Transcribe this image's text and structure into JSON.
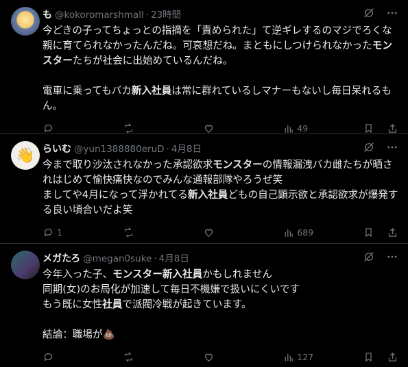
{
  "tweets": [
    {
      "name": "も",
      "handle": "@kokoromarshmall",
      "time": "23時間",
      "text": "今どきの子ってちょっとの指摘を「責められた」て逆ギレするのマジでろくな親に育てられなかったんだね。可哀想だね。まともにしつけられなかった<b>モンスター</b>たちが社会に出始めているんだね。\n\n電車に乗ってもバカ<b>新入社員</b>は常に群れているしマナーもないし毎日呆れるもん。",
      "replies": "",
      "reposts": "",
      "likes": "",
      "views": "49"
    },
    {
      "name": "らいむ",
      "handle": "@yun1388880eruD",
      "time": "4月8日",
      "text": "今まで取り沙汰されなかった承認欲求<b>モンスター</b>の情報漏洩バカ雌たちが晒されはじめて愉快痛快なのでみんな通報部隊やろうぜ笑\nましてや4月になって浮かれてる<b>新入社員</b>どもの自己顕示欲と承認欲求が爆発する良い頃合いだよ笑",
      "replies": "1",
      "reposts": "",
      "likes": "",
      "views": "689"
    },
    {
      "name": "メガたろ",
      "handle": "@megan0suke",
      "time": "4月8日",
      "text": "今年入った子、<b>モンスター新入社員</b>かもしれません\n同期(女)のお局化が加速して毎日不機嫌で扱いにくいです\nもう既に女性<b>社員</b>で派閥冷戦が起きています。\n\n結論：職場が💩",
      "replies": "",
      "reposts": "",
      "likes": "",
      "views": "127"
    }
  ],
  "colors": {
    "bg": "#000000",
    "text": "#e7e9ea",
    "muted": "#71767b",
    "border": "#2f3336"
  },
  "icons": [
    "grok-icon",
    "more-icon",
    "reply-icon",
    "repost-icon",
    "like-icon",
    "views-icon",
    "bookmark-icon",
    "share-icon"
  ]
}
